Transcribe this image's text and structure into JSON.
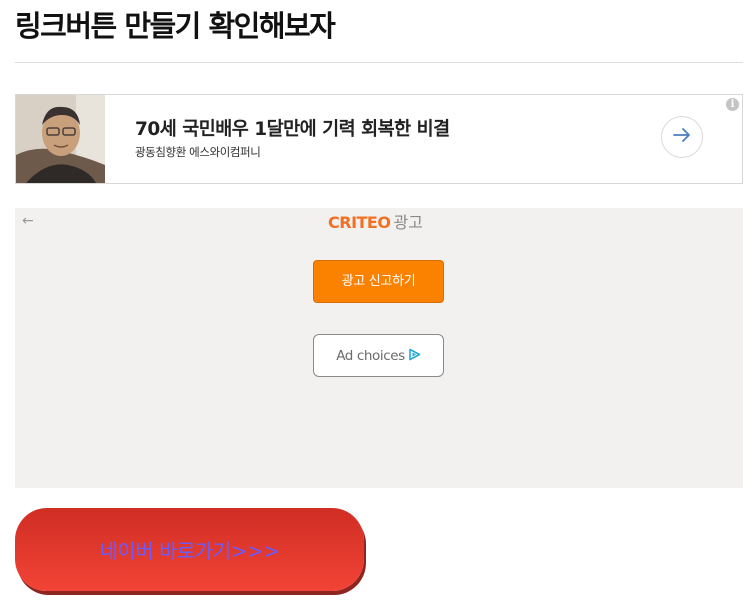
{
  "page": {
    "title": "링크버튼 만들기 확인해보자"
  },
  "native_ad": {
    "headline": "70세 국민배우 1달만에 기력 회복한 비결",
    "sponsor": "광동침향환 에스와이컴퍼니",
    "info_symbol": "i"
  },
  "criteo": {
    "back_symbol": "←",
    "logo_text": "CRITEO",
    "ad_label": "광고",
    "report_button": "광고 신고하기",
    "adchoices_label": "Ad choices"
  },
  "link_button": {
    "label": "네이버 바로가기>>>"
  },
  "colors": {
    "criteo_orange": "#fb8100",
    "link_button_red": "#e53a2e",
    "link_text": "#6a5cff"
  }
}
